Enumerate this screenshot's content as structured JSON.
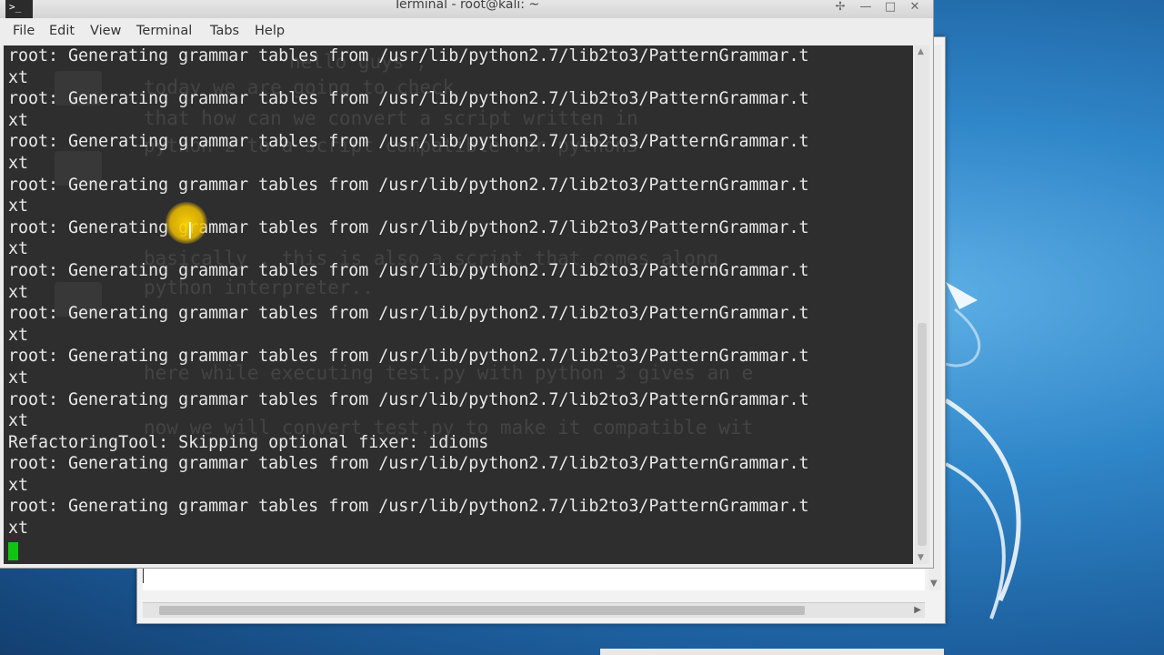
{
  "window": {
    "title": "Terminal - root@kali: ~",
    "app_icon": ">_",
    "buttons": {
      "pin": "✢",
      "minimize": "—",
      "maximize": "□",
      "close": "✕"
    }
  },
  "menu": [
    "File",
    "Edit",
    "View",
    "Terminal",
    "Tabs",
    "Help"
  ],
  "terminal": {
    "lines": [
      "root: Generating grammar tables from /usr/lib/python2.7/lib2to3/PatternGrammar.t",
      "xt",
      "root: Generating grammar tables from /usr/lib/python2.7/lib2to3/PatternGrammar.t",
      "xt",
      "root: Generating grammar tables from /usr/lib/python2.7/lib2to3/PatternGrammar.t",
      "xt",
      "root: Generating grammar tables from /usr/lib/python2.7/lib2to3/PatternGrammar.t",
      "xt",
      "root: Generating grammar tables from /usr/lib/python2.7/lib2to3/PatternGrammar.t",
      "xt",
      "root: Generating grammar tables from /usr/lib/python2.7/lib2to3/PatternGrammar.t",
      "xt",
      "root: Generating grammar tables from /usr/lib/python2.7/lib2to3/PatternGrammar.t",
      "xt",
      "root: Generating grammar tables from /usr/lib/python2.7/lib2to3/PatternGrammar.t",
      "xt",
      "root: Generating grammar tables from /usr/lib/python2.7/lib2to3/PatternGrammar.t",
      "xt",
      "RefactoringTool: Skipping optional fixer: idioms",
      "root: Generating grammar tables from /usr/lib/python2.7/lib2to3/PatternGrammar.t",
      "xt",
      "root: Generating grammar tables from /usr/lib/python2.7/lib2to3/PatternGrammar.t",
      "xt"
    ],
    "background_color": "#2e2e2e",
    "text_color": "#e8e8e8",
    "cursor_color": "#12c412"
  },
  "background_editor": {
    "ghost_lines": [
      "hello guys ,",
      "today we are going to check",
      "that how can we convert a script written in",
      "python 2 to a script compatible for python3",
      "basically , this is also a script that comes along",
      "python interpreter..",
      "here while executing test.py with python 3 gives an e",
      "now we will convert test.py to make it compatible wit"
    ]
  },
  "colors": {
    "mouse_highlight": "#f0c000",
    "desktop": "#2f86c8"
  }
}
